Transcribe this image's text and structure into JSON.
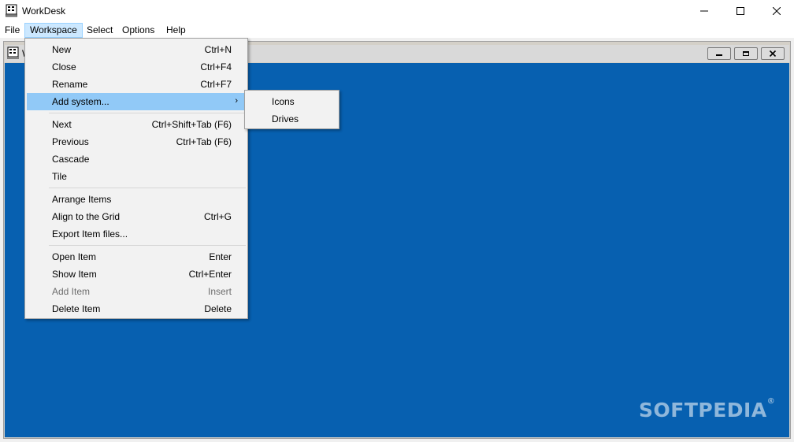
{
  "window": {
    "title": "WorkDesk",
    "icon": "workdesk-app-icon"
  },
  "menubar": {
    "items": [
      {
        "label": "File"
      },
      {
        "label": "Workspace"
      },
      {
        "label": "Select"
      },
      {
        "label": "Options"
      },
      {
        "label": "Help"
      }
    ],
    "active": "Workspace"
  },
  "child_window": {
    "title_fragment": "W"
  },
  "workspace_menu": {
    "items": [
      {
        "label": "New",
        "shortcut": "Ctrl+N"
      },
      {
        "label": "Close",
        "shortcut": "Ctrl+F4"
      },
      {
        "label": "Rename",
        "shortcut": "Ctrl+F7"
      },
      {
        "label": "Add system...",
        "shortcut": "",
        "submenu_arrow": "›"
      },
      {
        "label": "Next",
        "shortcut": "Ctrl+Shift+Tab (F6)"
      },
      {
        "label": "Previous",
        "shortcut": "Ctrl+Tab (F6)"
      },
      {
        "label": "Cascade",
        "shortcut": ""
      },
      {
        "label": "Tile",
        "shortcut": ""
      },
      {
        "label": "Arrange Items",
        "shortcut": ""
      },
      {
        "label": "Align to the Grid",
        "shortcut": "Ctrl+G"
      },
      {
        "label": "Export Item files...",
        "shortcut": ""
      },
      {
        "label": "Open Item",
        "shortcut": "Enter"
      },
      {
        "label": "Show Item",
        "shortcut": "Ctrl+Enter"
      },
      {
        "label": "Add Item",
        "shortcut": "Insert",
        "disabled": true
      },
      {
        "label": "Delete Item",
        "shortcut": "Delete"
      }
    ],
    "highlighted": "Add system..."
  },
  "add_system_submenu": {
    "items": [
      {
        "label": "Icons"
      },
      {
        "label": "Drives"
      }
    ]
  },
  "watermark": {
    "text": "SOFTPEDIA",
    "mark": "®"
  },
  "colors": {
    "workspace_bg": "#0760b0",
    "menu_highlight": "#91c9f7",
    "menubar_active": "#cce8ff"
  }
}
